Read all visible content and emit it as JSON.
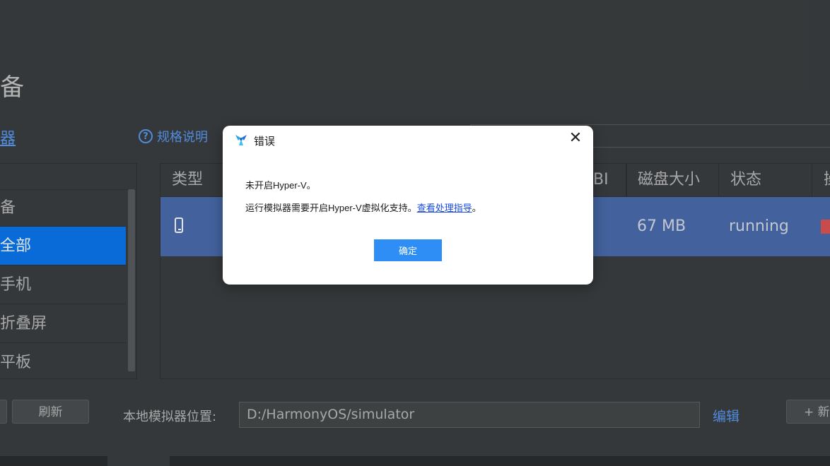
{
  "page": {
    "title": "备",
    "sidebar_heading": "器",
    "spec_link": "规格说明"
  },
  "sidebar": {
    "items": [
      {
        "label": "备",
        "selected": false
      },
      {
        "label": "全部",
        "selected": true
      },
      {
        "label": "手机",
        "selected": false
      },
      {
        "label": "折叠屏",
        "selected": false
      },
      {
        "label": "平板",
        "selected": false
      }
    ]
  },
  "table": {
    "headers": [
      "类型",
      "BI",
      "磁盘大小",
      "状态",
      "操"
    ],
    "rows": [
      {
        "type_icon": "phone-icon",
        "disk_size": "67 MB",
        "status": "running",
        "action_icon": "stop-icon"
      }
    ]
  },
  "bottom": {
    "refresh_label": "刷新",
    "location_label": "本地模拟器位置:",
    "location_value": "D:/HarmonyOS/simulator",
    "edit_label": "编辑",
    "new_label": "+ 新"
  },
  "dialog": {
    "title": "错误",
    "message_line1": "未开启Hyper-V。",
    "message_line2_prefix": "运行模拟器需要开启Hyper-V虚拟化支持。",
    "guide_link": "查看处理指导",
    "message_line2_suffix": "。",
    "ok_label": "确定",
    "close_icon": "close-icon",
    "logo_icon": "app-logo-icon"
  },
  "colors": {
    "background": "#3c3f41",
    "selection": "#0a78f0",
    "row_selected": "#4b6eaf",
    "link": "#5b9bf4",
    "dialog_button": "#2e8ef5"
  }
}
